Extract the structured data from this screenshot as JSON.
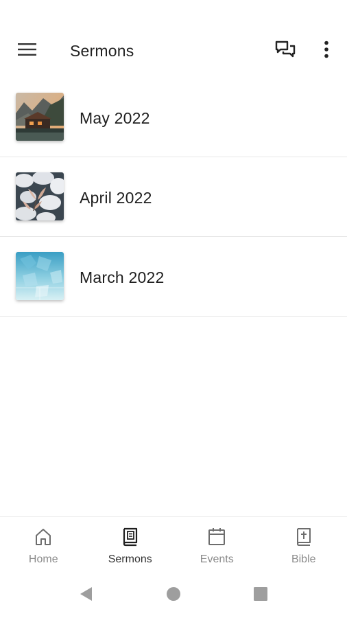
{
  "header": {
    "title": "Sermons",
    "menu_icon": "hamburger-menu-icon",
    "chat_icon": "chat-bubbles-icon",
    "more_icon": "more-vertical-icon"
  },
  "sermon_series": [
    {
      "label": "May 2022",
      "thumbnail": "mountain-lodge-photo"
    },
    {
      "label": "April 2022",
      "thumbnail": "magnolia-blossoms-photo"
    },
    {
      "label": "March 2022",
      "thumbnail": "blue-ice-photo"
    }
  ],
  "bottom_nav": {
    "items": [
      {
        "label": "Home",
        "icon": "home-icon",
        "active": false
      },
      {
        "label": "Sermons",
        "icon": "book-icon",
        "active": true
      },
      {
        "label": "Events",
        "icon": "calendar-icon",
        "active": false
      },
      {
        "label": "Bible",
        "icon": "bible-icon",
        "active": false
      }
    ]
  },
  "system_nav": {
    "back_icon": "back-triangle-icon",
    "home_icon": "home-circle-icon",
    "recents_icon": "recents-square-icon"
  },
  "colors": {
    "background": "#ffffff",
    "divider": "#e6e6e6",
    "text": "#1e1e1e",
    "nav_inactive": "#8a8a8a",
    "system_nav": "#9e9e9e"
  }
}
